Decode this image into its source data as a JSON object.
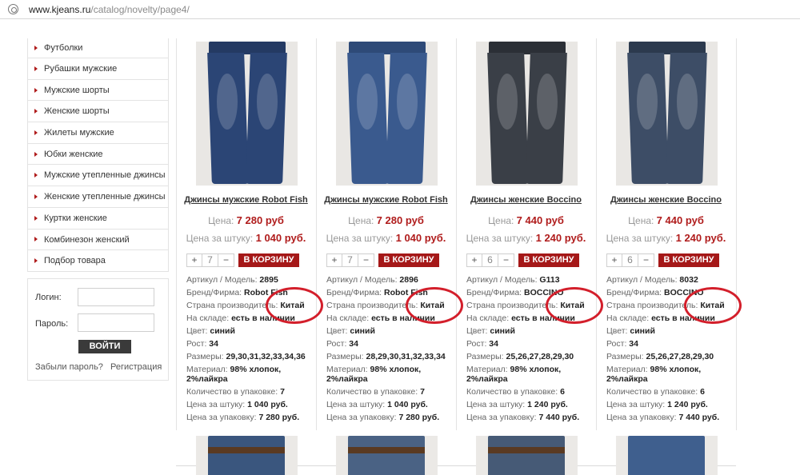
{
  "address_bar": {
    "domain": "www.kjeans.ru",
    "path": "/catalog/novelty/page4/"
  },
  "sidebar": {
    "categories": [
      {
        "label": "Футболки"
      },
      {
        "label": "Рубашки мужские"
      },
      {
        "label": "Мужские шорты"
      },
      {
        "label": "Женские шорты"
      },
      {
        "label": "Жилеты мужские"
      },
      {
        "label": "Юбки женские"
      },
      {
        "label": "Мужские утепленные джинсы"
      },
      {
        "label": "Женские утепленные джинсы"
      },
      {
        "label": "Куртки женские"
      },
      {
        "label": "Комбинезон женский"
      },
      {
        "label": "Подбор товара"
      }
    ],
    "login": {
      "login_label": "Логин:",
      "password_label": "Пароль:",
      "login_value": "",
      "password_value": "",
      "submit_label": "ВОЙТИ",
      "forgot_link": "Забыли пароль?",
      "register_link": "Регистрация"
    }
  },
  "colors": {
    "accent": "#a51818",
    "price": "#b01c1c",
    "highlight_ring": "#d31f2b"
  },
  "products": [
    {
      "title": "Джинсы мужские Robot Fish",
      "price_label": "Цена:",
      "price": "7 280 руб",
      "unit_price_label": "Цена за штуку:",
      "unit_price": "1 040 руб.",
      "qty_minus": "+",
      "qty": "7",
      "qty_plus": "−",
      "cart_label": "В КОРЗИНУ",
      "specs": [
        {
          "label": "Артикул / Модель: ",
          "value": "2895"
        },
        {
          "label": "Бренд/Фирма: ",
          "value": "Robot Fish"
        },
        {
          "label": "Страна производитель: ",
          "value": "Китай"
        },
        {
          "label": "На складе: ",
          "value": "есть в наличии"
        },
        {
          "label": "Цвет: ",
          "value": "синий"
        },
        {
          "label": "Рост: ",
          "value": "34"
        },
        {
          "label": "Размеры: ",
          "value": "29,30,31,32,33,34,36"
        },
        {
          "label": "Материал: ",
          "value": "98% хлопок,"
        },
        {
          "label": "",
          "value": "2%лайкра"
        },
        {
          "label": "Количество в упаковке: ",
          "value": "7"
        },
        {
          "label": "Цена за штуку: ",
          "value": "1 040 руб."
        },
        {
          "label": "Цена за упаковку: ",
          "value": "7 280 руб."
        }
      ]
    },
    {
      "title": "Джинсы мужские Robot Fish",
      "price_label": "Цена:",
      "price": "7 280 руб",
      "unit_price_label": "Цена за штуку:",
      "unit_price": "1 040 руб.",
      "qty_minus": "+",
      "qty": "7",
      "qty_plus": "−",
      "cart_label": "В КОРЗИНУ",
      "specs": [
        {
          "label": "Артикул / Модель: ",
          "value": "2896"
        },
        {
          "label": "Бренд/Фирма: ",
          "value": "Robot Fish"
        },
        {
          "label": "Страна производитель: ",
          "value": "Китай"
        },
        {
          "label": "На складе: ",
          "value": "есть в наличии"
        },
        {
          "label": "Цвет: ",
          "value": "синий"
        },
        {
          "label": "Рост: ",
          "value": "34"
        },
        {
          "label": "Размеры: ",
          "value": "28,29,30,31,32,33,34"
        },
        {
          "label": "Материал: ",
          "value": "98% хлопок,"
        },
        {
          "label": "",
          "value": "2%лайкра"
        },
        {
          "label": "Количество в упаковке: ",
          "value": "7"
        },
        {
          "label": "Цена за штуку: ",
          "value": "1 040 руб."
        },
        {
          "label": "Цена за упаковку: ",
          "value": "7 280 руб."
        }
      ]
    },
    {
      "title": "Джинсы женские Boccino",
      "price_label": "Цена:",
      "price": "7 440 руб",
      "unit_price_label": "Цена за штуку:",
      "unit_price": "1 240 руб.",
      "qty_minus": "+",
      "qty": "6",
      "qty_plus": "−",
      "cart_label": "В КОРЗИНУ",
      "specs": [
        {
          "label": "Артикул / Модель: ",
          "value": "G113"
        },
        {
          "label": "Бренд/Фирма: ",
          "value": "BOCCINO"
        },
        {
          "label": "Страна производитель: ",
          "value": "Китай"
        },
        {
          "label": "На складе: ",
          "value": "есть в наличии"
        },
        {
          "label": "Цвет: ",
          "value": "синий"
        },
        {
          "label": "Рост: ",
          "value": "34"
        },
        {
          "label": "Размеры: ",
          "value": "25,26,27,28,29,30"
        },
        {
          "label": "Материал: ",
          "value": "98% хлопок,"
        },
        {
          "label": "",
          "value": "2%лайкра"
        },
        {
          "label": "Количество в упаковке: ",
          "value": "6"
        },
        {
          "label": "Цена за штуку: ",
          "value": "1 240 руб."
        },
        {
          "label": "Цена за упаковку: ",
          "value": "7 440 руб."
        }
      ]
    },
    {
      "title": "Джинсы женские Boccino",
      "price_label": "Цена:",
      "price": "7 440 руб",
      "unit_price_label": "Цена за штуку:",
      "unit_price": "1 240 руб.",
      "qty_minus": "+",
      "qty": "6",
      "qty_plus": "−",
      "cart_label": "В КОРЗИНУ",
      "specs": [
        {
          "label": "Артикул / Модель: ",
          "value": "8032"
        },
        {
          "label": "Бренд/Фирма: ",
          "value": "BOCCINO"
        },
        {
          "label": "Страна производитель: ",
          "value": "Китай"
        },
        {
          "label": "На складе: ",
          "value": "есть в наличии"
        },
        {
          "label": "Цвет: ",
          "value": "синий"
        },
        {
          "label": "Рост: ",
          "value": "34"
        },
        {
          "label": "Размеры: ",
          "value": "25,26,27,28,29,30"
        },
        {
          "label": "Материал: ",
          "value": "98% хлопок,"
        },
        {
          "label": "",
          "value": "2%лайкра"
        },
        {
          "label": "Количество в упаковке: ",
          "value": "6"
        },
        {
          "label": "Цена за штуку: ",
          "value": "1 240 руб."
        },
        {
          "label": "Цена за упаковку: ",
          "value": "7 440 руб."
        }
      ]
    }
  ]
}
